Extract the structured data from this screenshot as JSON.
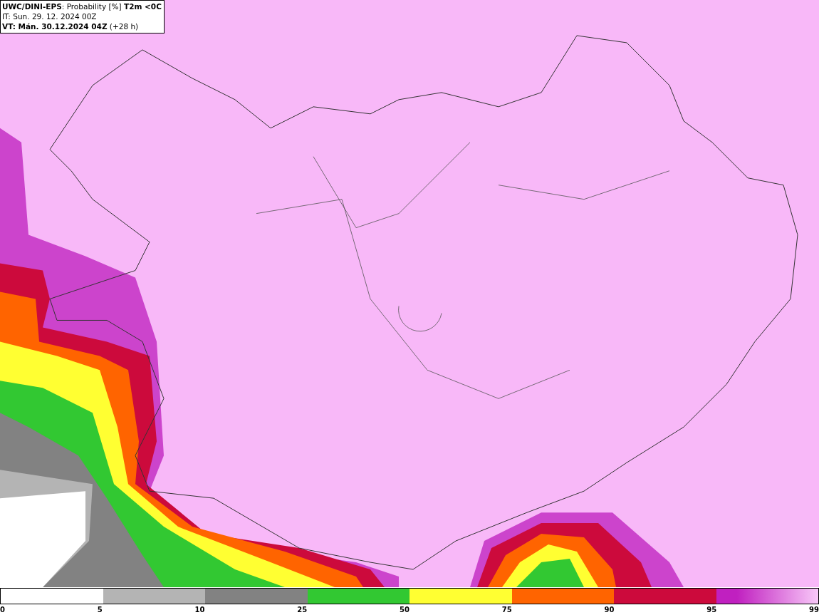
{
  "header": {
    "title": "**UWC/DINI-EPS**: Probability [%] **T2m <0C**",
    "init_time": "IT: Sun. 29. 12. 2024 00Z",
    "valid_time": "**VT: Mán. 30.12.2024 04Z** (+28 h)"
  },
  "legend": {
    "segments": [
      {
        "color": "#b4b4b4"
      },
      {
        "color": "#828282"
      },
      {
        "color": "#32c832"
      },
      {
        "color": "#ffff32"
      },
      {
        "color": "#ff6400"
      },
      {
        "color": "#cc0a3c"
      },
      {
        "color": "#c020c0"
      }
    ],
    "ticks": [
      "0",
      "5",
      "10",
      "25",
      "50",
      "75",
      "90",
      "95",
      "99"
    ]
  }
}
